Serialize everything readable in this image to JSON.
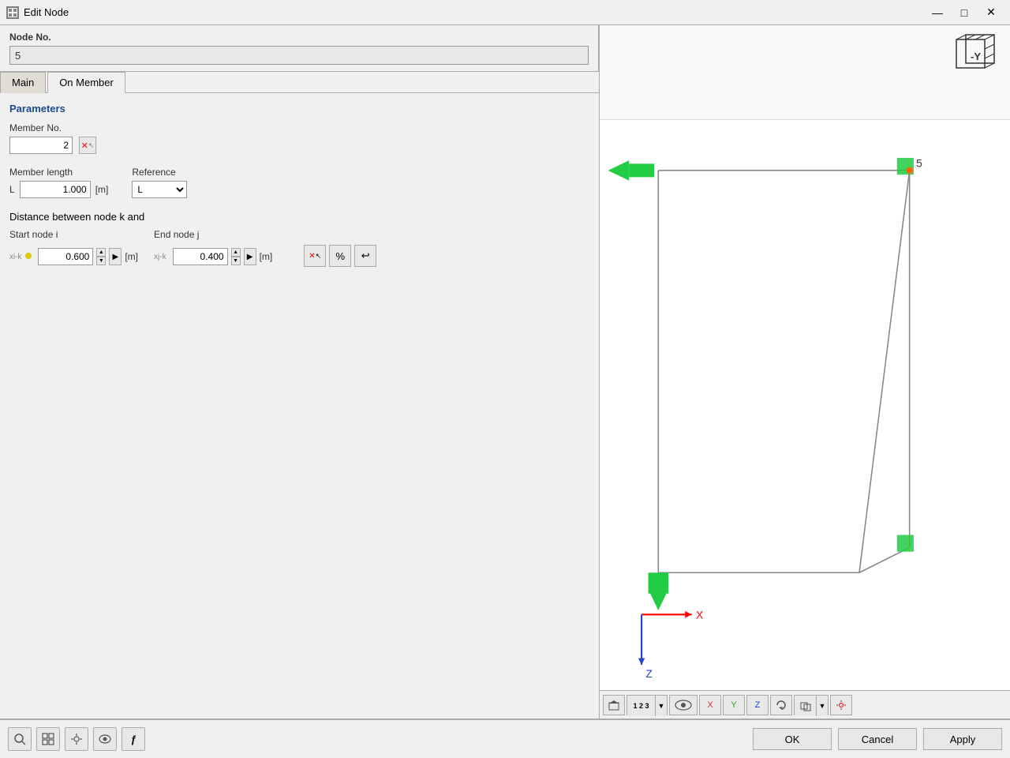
{
  "titleBar": {
    "icon": "⬛",
    "title": "Edit Node",
    "minimizeLabel": "—",
    "maximizeLabel": "□",
    "closeLabel": "✕"
  },
  "topSection": {
    "nodeNoLabel": "Node No.",
    "nodeNoValue": "5"
  },
  "tabs": [
    {
      "id": "main",
      "label": "Main",
      "active": false
    },
    {
      "id": "on-member",
      "label": "On Member",
      "active": true
    }
  ],
  "parameters": {
    "sectionTitle": "Parameters",
    "memberNo": {
      "label": "Member No.",
      "value": "2",
      "clearBtnLabel": "✕"
    },
    "memberLength": {
      "label": "Member length",
      "fieldLabel": "L",
      "value": "1.000",
      "unit": "[m]"
    },
    "reference": {
      "label": "Reference",
      "fieldLabel": "L",
      "options": [
        "L"
      ]
    },
    "distanceLabel": "Distance between node k and",
    "startNode": {
      "label": "Start node i",
      "fieldLabel": "xi-k",
      "value": "0.600",
      "unit": "[m]"
    },
    "endNode": {
      "label": "End node j",
      "fieldLabel": "xj-k",
      "value": "0.400",
      "unit": "[m]"
    },
    "actionBtns": {
      "pickLabel": "↖",
      "percentLabel": "%",
      "resetLabel": "↩"
    }
  },
  "viewport": {
    "node5Label": "5",
    "axisX": "X",
    "axisZ": "Z",
    "viewportToolbar": {
      "homeBtn": "⌂",
      "numbersBtn": "123",
      "hideBtn": "👁",
      "xBtn": "X",
      "yBtn": "Y",
      "zBtn": "Z",
      "rotateBtn": "↻",
      "renderBtn": "□",
      "settingsBtn": "⚙"
    }
  },
  "bottomBar": {
    "tools": [
      {
        "id": "search",
        "label": "🔍"
      },
      {
        "id": "grid",
        "label": "⊞"
      },
      {
        "id": "snap",
        "label": "✛"
      },
      {
        "id": "view",
        "label": "👁"
      },
      {
        "id": "func",
        "label": "ƒ"
      }
    ],
    "okLabel": "OK",
    "cancelLabel": "Cancel",
    "applyLabel": "Apply"
  }
}
